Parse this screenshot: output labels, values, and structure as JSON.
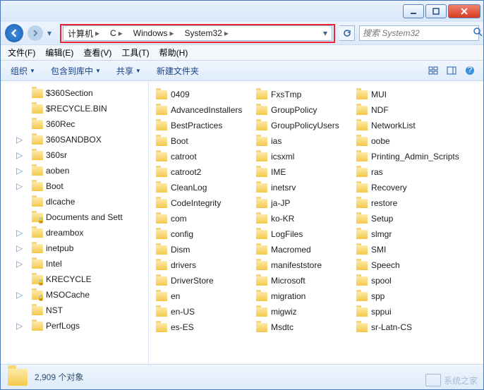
{
  "window": {
    "title": ""
  },
  "nav": {
    "crumbs": [
      "计算机",
      "C",
      "Windows",
      "System32"
    ],
    "search_placeholder": "搜索 System32"
  },
  "menu": {
    "file": "文件(F)",
    "edit": "编辑(E)",
    "view": "查看(V)",
    "tools": "工具(T)",
    "help": "帮助(H)"
  },
  "toolbar": {
    "organize": "组织",
    "include": "包含到库中",
    "share": "共享",
    "newfolder": "新建文件夹"
  },
  "tree": [
    {
      "label": "$360Section",
      "exp": false,
      "lock": false
    },
    {
      "label": "$RECYCLE.BIN",
      "exp": false,
      "lock": false
    },
    {
      "label": "360Rec",
      "exp": false,
      "lock": false
    },
    {
      "label": "360SANDBOX",
      "exp": true,
      "lock": false
    },
    {
      "label": "360sr",
      "exp": true,
      "lock": false
    },
    {
      "label": "aoben",
      "exp": true,
      "lock": false
    },
    {
      "label": "Boot",
      "exp": true,
      "lock": false
    },
    {
      "label": "dlcache",
      "exp": false,
      "lock": false
    },
    {
      "label": "Documents and Sett",
      "exp": false,
      "lock": true
    },
    {
      "label": "dreambox",
      "exp": true,
      "lock": false
    },
    {
      "label": "inetpub",
      "exp": true,
      "lock": false
    },
    {
      "label": "Intel",
      "exp": true,
      "lock": false
    },
    {
      "label": "KRECYCLE",
      "exp": false,
      "lock": true
    },
    {
      "label": "MSOCache",
      "exp": true,
      "lock": true
    },
    {
      "label": "NST",
      "exp": false,
      "lock": false
    },
    {
      "label": "PerfLogs",
      "exp": true,
      "lock": false
    }
  ],
  "files": {
    "col1": [
      "0409",
      "AdvancedInstallers",
      "BestPractices",
      "Boot",
      "catroot",
      "catroot2",
      "CleanLog",
      "CodeIntegrity",
      "com",
      "config",
      "Dism",
      "drivers",
      "DriverStore",
      "en",
      "en-US",
      "es-ES"
    ],
    "col2": [
      "FxsTmp",
      "GroupPolicy",
      "GroupPolicyUsers",
      "ias",
      "icsxml",
      "IME",
      "inetsrv",
      "ja-JP",
      "ko-KR",
      "LogFiles",
      "Macromed",
      "manifeststore",
      "Microsoft",
      "migration",
      "migwiz",
      "Msdtc"
    ],
    "col3": [
      "MUI",
      "NDF",
      "NetworkList",
      "oobe",
      "Printing_Admin_Scripts",
      "ras",
      "Recovery",
      "restore",
      "Setup",
      "slmgr",
      "SMI",
      "Speech",
      "spool",
      "spp",
      "sppui",
      "sr-Latn-CS"
    ]
  },
  "status": {
    "count_text": "2,909 个对象"
  },
  "watermark": {
    "text": "系统之家"
  }
}
